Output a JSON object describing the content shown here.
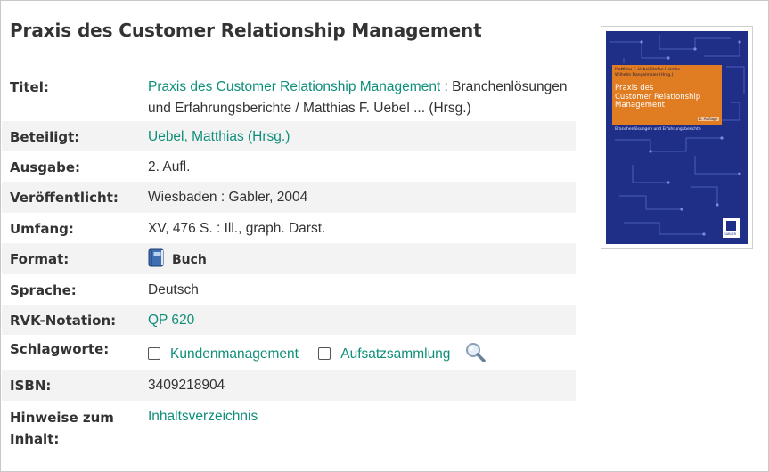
{
  "title": "Praxis des Customer Relationship Management",
  "rows": [
    {
      "label": "Titel:",
      "link": "Praxis des Customer Relationship Management",
      "text": " : Branchenlösungen und Erfahrungsberichte / Matthias F. Uebel ... (Hrsg.)"
    },
    {
      "label": "Beteiligt:",
      "link": "Uebel, Matthias (Hrsg.)"
    },
    {
      "label": "Ausgabe:",
      "text": "2. Aufl."
    },
    {
      "label": "Veröffentlicht:",
      "text": "Wiesbaden : Gabler, 2004"
    },
    {
      "label": "Umfang:",
      "text": "XV, 476 S. : Ill., graph. Darst."
    },
    {
      "label": "Format:",
      "text": "Buch",
      "icon": "book-icon"
    },
    {
      "label": "Sprache:",
      "text": "Deutsch"
    },
    {
      "label": "RVK-Notation:",
      "link": "QP 620"
    },
    {
      "label": "Schlagworte:",
      "keywords": [
        "Kundenmanagement",
        "Aufsatzsammlung"
      ],
      "icon": "magnifier-icon"
    },
    {
      "label": "ISBN:",
      "text": "3409218904"
    },
    {
      "label": "Hinweise zum Inhalt:",
      "link": "Inhaltsverzeichnis"
    }
  ],
  "cover": {
    "authors": [
      "Matthias F. Uebel/Stefan Helmke",
      "Wilhelm Dangelmaier (Hrsg.)"
    ],
    "title_lines": [
      "Praxis des",
      "Customer Relationship",
      "Management"
    ],
    "edition": "2. Auflage",
    "subtitle": "Branchenlösungen und Erfahrungsberichte",
    "publisher": "GABLER"
  },
  "colors": {
    "link": "#0f8f7a",
    "row_shade": "#f3f3f3",
    "cover_blue": "#1f2f87",
    "cover_orange": "#e07c22"
  }
}
